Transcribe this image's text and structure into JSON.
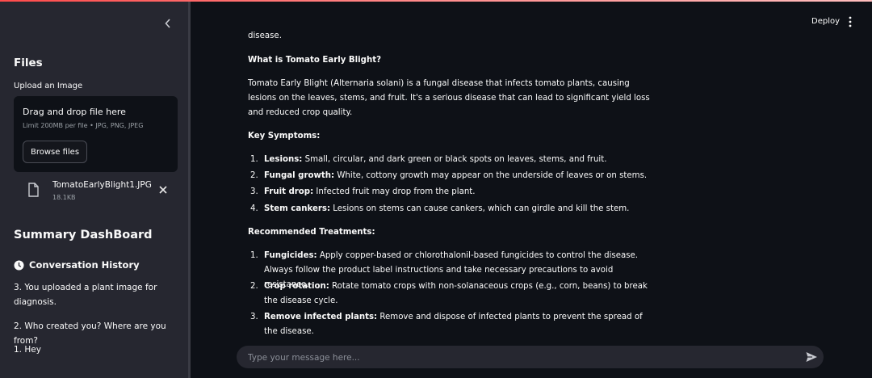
{
  "sidebar": {
    "files_heading": "Files",
    "upload_label": "Upload an Image",
    "dropzone": {
      "title": "Drag and drop file here",
      "limit": "Limit 200MB per file • JPG, PNG, JPEG",
      "browse_label": "Browse files"
    },
    "uploaded_file": {
      "name": "TomatoEarlyBlight1.JPG",
      "size": "18.1KB"
    },
    "summary_heading": "Summary DashBoard",
    "conversation_heading": "Conversation History",
    "history": [
      "3. You uploaded a plant image for diagnosis.",
      "2. Who created you? Where are you from?",
      "1. Hey"
    ]
  },
  "header": {
    "deploy_label": "Deploy"
  },
  "message": {
    "fragment": "disease.",
    "question": "What is Tomato Early Blight?",
    "intro": "Tomato Early Blight (Alternaria solani) is a fungal disease that infects tomato plants, causing lesions on the leaves, stems, and fruit. It's a serious disease that can lead to significant yield loss and reduced crop quality.",
    "symptoms_heading": "Key Symptoms:",
    "symptoms": [
      {
        "num": "1.",
        "term": "Lesions:",
        "text": " Small, circular, and dark green or black spots on leaves, stems, and fruit."
      },
      {
        "num": "2.",
        "term": "Fungal growth:",
        "text": " White, cottony growth may appear on the underside of leaves or on stems."
      },
      {
        "num": "3.",
        "term": "Fruit drop:",
        "text": " Infected fruit may drop from the plant."
      },
      {
        "num": "4.",
        "term": "Stem cankers:",
        "text": " Lesions on stems can cause cankers, which can girdle and kill the stem."
      }
    ],
    "treatments_heading": "Recommended Treatments:",
    "treatments": [
      {
        "num": "1.",
        "term": "Fungicides:",
        "text": " Apply copper-based or chlorothalonil-based fungicides to control the disease. Always follow the product label instructions and take necessary precautions to avoid resistance."
      },
      {
        "num": "2.",
        "term": "Crop rotation:",
        "text": " Rotate tomato crops with non-solanaceous crops (e.g., corn, beans) to break the disease cycle."
      },
      {
        "num": "3.",
        "term": "Remove infected plants:",
        "text": " Remove and dispose of infected plants to prevent the spread of the disease."
      }
    ]
  },
  "chat": {
    "placeholder": "Type your message here..."
  },
  "colors": {
    "accent": "#ff4b4b",
    "background": "#0e1117",
    "sidebar": "#262730"
  },
  "icons": [
    "chevron-left-icon",
    "file-icon",
    "close-icon",
    "clock-icon",
    "more-vertical-icon",
    "send-icon"
  ]
}
